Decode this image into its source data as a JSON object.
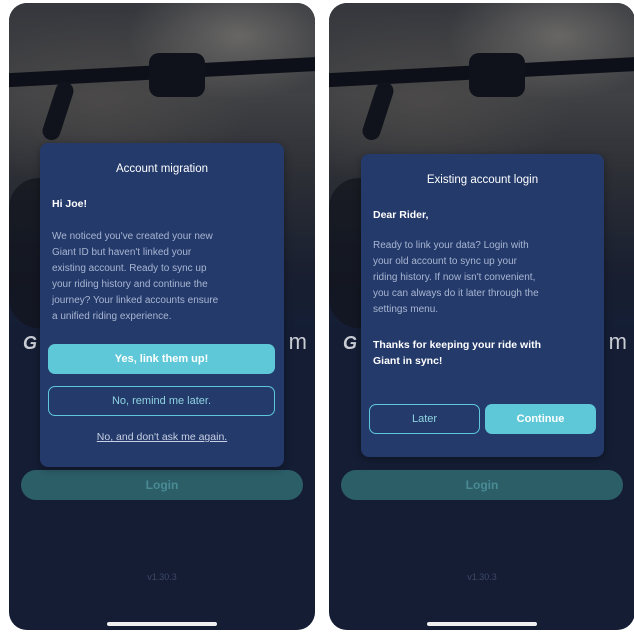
{
  "screens": [
    {
      "background": {
        "brand_mark_left": "G",
        "brand_mark_right": "m",
        "login_label": "Login",
        "version": "v1.30.3"
      },
      "dialog": {
        "title": "Account migration",
        "greeting": "Hi Joe!",
        "body_lines": [
          "We noticed you've created your new",
          "Giant ID but haven't linked your",
          "existing account. Ready to sync up",
          "your riding history and continue the",
          "journey? Your linked accounts ensure",
          "a unified riding experience."
        ],
        "primary_button": "Yes, link them up!",
        "secondary_button": "No, remind me later.",
        "dismiss_link": "No, and don't ask me again."
      }
    },
    {
      "background": {
        "brand_mark_left": "G",
        "brand_mark_right": "m",
        "login_label": "Login",
        "version": "v1.30.3"
      },
      "dialog": {
        "title": "Existing account login",
        "greeting": "Dear Rider,",
        "body_lines": [
          "Ready to link your data? Login with",
          "your old account to sync up your",
          "riding history. If now isn't convenient,",
          "you can always do it later through the",
          "settings menu."
        ],
        "emphasis_lines": [
          "Thanks for keeping your ride with",
          "Giant in sync!"
        ],
        "later_button": "Later",
        "continue_button": "Continue"
      }
    }
  ],
  "colors": {
    "dialog_bg": "#243a6b",
    "accent": "#5ec8d8",
    "screen_bg": "#17213a",
    "login_button": "#2c5e68"
  }
}
